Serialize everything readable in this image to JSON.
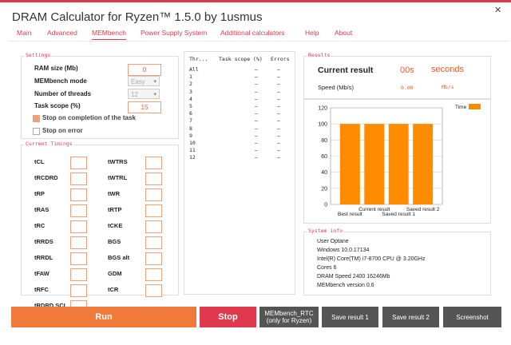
{
  "window": {
    "title": "DRAM Calculator for Ryzen™ 1.5.0 by 1usmus",
    "close": "✕"
  },
  "tabs": [
    {
      "label": "Main"
    },
    {
      "label": "Advanced"
    },
    {
      "label": "MEMbench"
    },
    {
      "label": "Power Supply System"
    },
    {
      "label": "Additional calculators"
    },
    {
      "label": "Help"
    },
    {
      "label": "About"
    }
  ],
  "settings": {
    "title": "Settings",
    "ram_size_label": "RAM size (Mb)",
    "ram_size_value": "0",
    "mode_label": "MEMbench mode",
    "mode_value": "Easy",
    "threads_label": "Number of threads",
    "threads_value": "12",
    "scope_label": "Task scope (%)",
    "scope_value": "15",
    "stop_completion_label": "Stop on completion of the task",
    "stop_error_label": "Stop on error"
  },
  "timings": {
    "title": "Current Timings",
    "left": [
      "tCL",
      "tRCDRD",
      "tRP",
      "tRAS",
      "tRC",
      "tRRDS",
      "tRRDL",
      "tFAW",
      "tRFC",
      "tRDRD SCL"
    ],
    "right": [
      "tWTRS",
      "tWTRL",
      "tWR",
      "tRTP",
      "tCKE",
      "BGS",
      "BGS alt",
      "GDM",
      "tCR"
    ]
  },
  "threads_table": {
    "headers": [
      "Thr...",
      "Task scope (%)",
      "Errors"
    ],
    "rows": [
      [
        "All",
        "–",
        "–"
      ],
      [
        "1",
        "–",
        "–"
      ],
      [
        "2",
        "–",
        "–"
      ],
      [
        "3",
        "–",
        "–"
      ],
      [
        "4",
        "–",
        "–"
      ],
      [
        "5",
        "–",
        "–"
      ],
      [
        "6",
        "–",
        "–"
      ],
      [
        "7",
        "–",
        "–"
      ],
      [
        "8",
        "–",
        "–"
      ],
      [
        "9",
        "–",
        "–"
      ],
      [
        "10",
        "–",
        "–"
      ],
      [
        "11",
        "–",
        "–"
      ],
      [
        "12",
        "–",
        "–"
      ]
    ]
  },
  "results": {
    "title": "Results",
    "current_label": "Current result",
    "current_value": "00s",
    "current_unit": "seconds",
    "speed_label": "Speed (Mb/s)",
    "speed_value": "0.00",
    "speed_unit": "Mb/s"
  },
  "chart_data": {
    "type": "bar",
    "categories": [
      "Best result",
      "Current result",
      "Saved result 1",
      "Saved result 2"
    ],
    "series": [
      {
        "name": "Time",
        "values": [
          100,
          100,
          100,
          100
        ]
      }
    ],
    "ylim": [
      0,
      120
    ],
    "yticks": [
      0,
      20,
      40,
      60,
      80,
      100,
      120
    ],
    "grid": true,
    "legend": "top-right",
    "color": "#ff8c00"
  },
  "system_info": {
    "title": "System info",
    "lines": [
      "User Optane",
      "Windows 10.0.17134",
      "Intel(R) Core(TM) i7-8700 CPU @ 3.20GHz",
      "Cores 6",
      "DRAM Speed 2400   16246Mb",
      "MEMbench version 0.6"
    ]
  },
  "buttons": {
    "run": "Run",
    "stop": "Stop",
    "membench_rtc": "MEMbench_RTC",
    "membench_rtc_sub": "(only for Ryzen)",
    "save1": "Save result 1",
    "save2": "Save result 2",
    "screenshot": "Screenshot"
  }
}
